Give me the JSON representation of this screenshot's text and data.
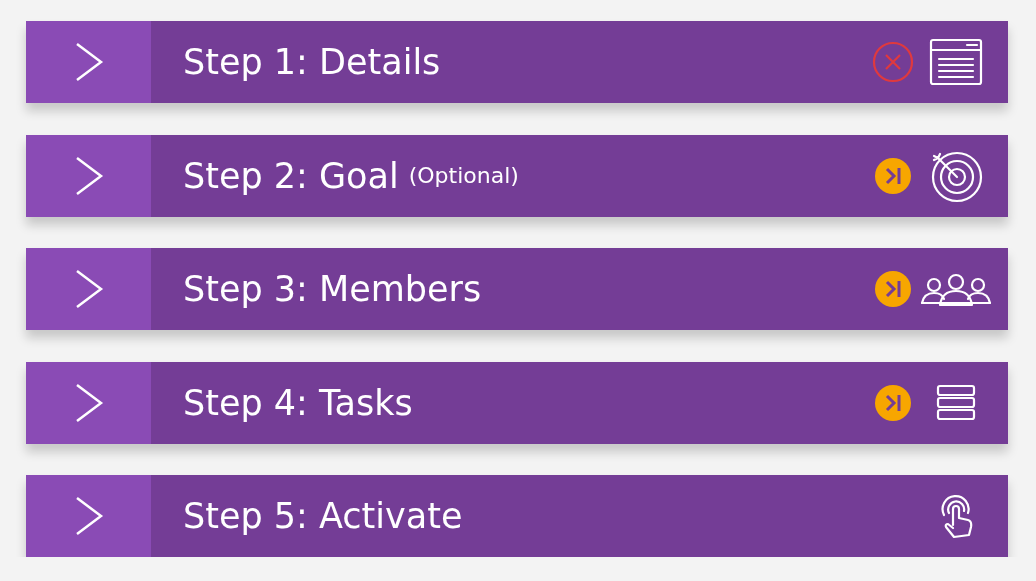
{
  "steps": [
    {
      "label": "Step 1: Details",
      "expanded": false,
      "failed": true,
      "skipped": false
    },
    {
      "label": "Step 2: Goal",
      "note": "(Optional)",
      "expanded": false,
      "failed": false,
      "skipped": true
    },
    {
      "label": "Step 3: Members",
      "expanded": false,
      "failed": false,
      "skipped": true
    },
    {
      "label": "Step 4: Tasks",
      "expanded": false,
      "failed": false,
      "skipped": true
    },
    {
      "label": "Step 5: Activate",
      "expanded": false,
      "failed": false,
      "skipped": false
    }
  ]
}
